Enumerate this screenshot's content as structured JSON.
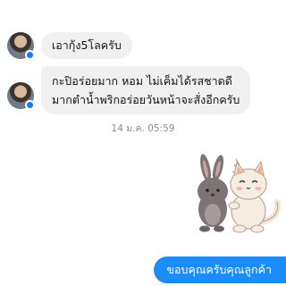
{
  "messages": {
    "incoming_1": "เอากุ้ง5โลครับ",
    "incoming_2_line1": "กะปิอร่อยมาก หอม ไม่เค็มได้รสชาดดี",
    "incoming_2_line2": "มากตำน้ำพริกอร่อยวันหน้าจะสั่งอีกครับ",
    "timestamp": "14 ม.ค. 05:59",
    "outgoing_1": "ขอบคุณครับคุณลูกค้า"
  },
  "sticker": {
    "name": "bunny-and-cat-sticker"
  },
  "colors": {
    "incoming_bubble": "#f0f0f0",
    "outgoing_bubble": "#1b8cfb",
    "messenger_badge": "#1877f2"
  }
}
